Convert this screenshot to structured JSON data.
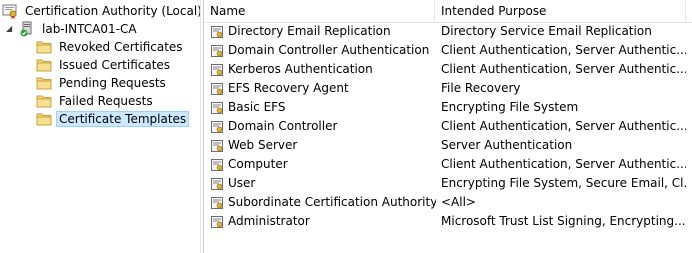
{
  "tree": {
    "root": {
      "label": "Certification Authority (Local)"
    },
    "ca": {
      "label": "lab-INTCA01-CA",
      "expander": "◢"
    },
    "folders": [
      {
        "label": "Revoked Certificates"
      },
      {
        "label": "Issued Certificates"
      },
      {
        "label": "Pending Requests"
      },
      {
        "label": "Failed Requests"
      },
      {
        "label": "Certificate Templates",
        "selected": true
      }
    ]
  },
  "list": {
    "columns": {
      "name": "Name",
      "purpose": "Intended Purpose"
    },
    "rows": [
      {
        "name": "Directory Email Replication",
        "purpose": "Directory Service Email Replication"
      },
      {
        "name": "Domain Controller Authentication",
        "purpose": "Client Authentication, Server Authentic..."
      },
      {
        "name": "Kerberos Authentication",
        "purpose": "Client Authentication, Server Authentic..."
      },
      {
        "name": "EFS Recovery Agent",
        "purpose": "File Recovery"
      },
      {
        "name": "Basic EFS",
        "purpose": "Encrypting File System"
      },
      {
        "name": "Domain Controller",
        "purpose": "Client Authentication, Server Authentic..."
      },
      {
        "name": "Web Server",
        "purpose": "Server Authentication"
      },
      {
        "name": "Computer",
        "purpose": "Client Authentication, Server Authentic..."
      },
      {
        "name": "User",
        "purpose": "Encrypting File System, Secure Email, Cl..."
      },
      {
        "name": "Subordinate Certification Authority",
        "purpose": "<All>"
      },
      {
        "name": "Administrator",
        "purpose": "Microsoft Trust List Signing, Encrypting..."
      }
    ]
  },
  "colors": {
    "selection_bg": "#cce8ff",
    "selection_border": "#99d1ff",
    "folder": "#f3d57a"
  },
  "icons": {
    "root": "certification-authority-icon",
    "ca": "ca-server-icon",
    "folder": "folder-icon",
    "template": "certificate-template-icon"
  }
}
